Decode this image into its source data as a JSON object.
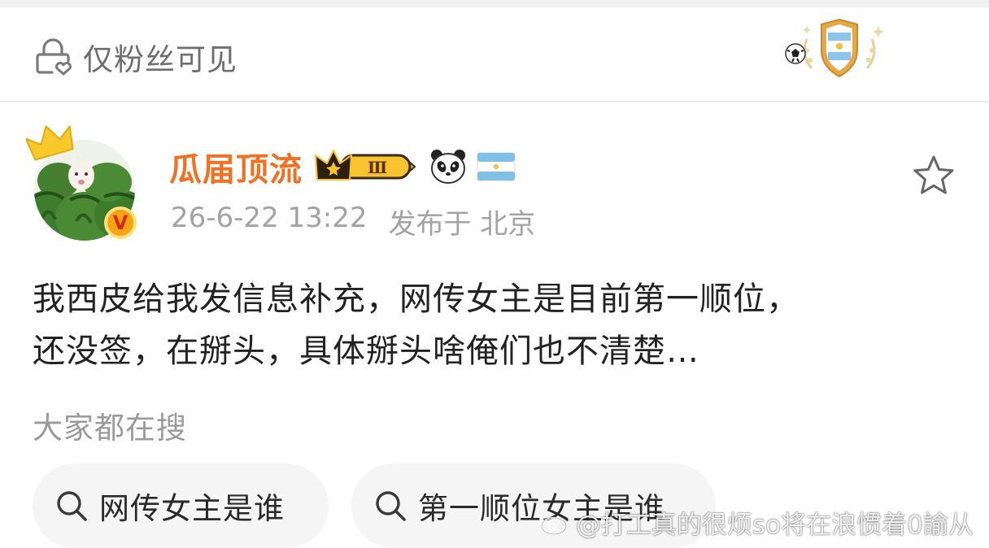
{
  "header": {
    "visibility_label": "仅粉丝可见"
  },
  "post": {
    "author": {
      "name": "瓜届顶流",
      "vip_level": "Ⅲ",
      "verified_mark": "V"
    },
    "time": "26-6-22 13:22",
    "location": "发布于 北京",
    "text_lines": [
      "我西皮给我发信息补充，网传女主是目前第一顺位，",
      "还没签，在掰头，具体掰头啥俺们也不清楚…"
    ]
  },
  "search": {
    "title": "大家都在搜",
    "chips": [
      {
        "label": "网传女主是谁"
      },
      {
        "label": "第一顺位女主是谁"
      }
    ]
  },
  "watermark": {
    "text": "@打工真的很烦so将在浪惯着0諭从"
  },
  "icons": {
    "visibility": "lock-heart-icon",
    "emblem": "argentina-football-emblem",
    "crown": "crown-icon",
    "star": "star-outline-icon",
    "search": "search-icon",
    "panda": "panda-emoji",
    "flag": "argentina-flag-emoji"
  },
  "colors": {
    "username": "#f07124",
    "secondary_text": "#a3a3a3",
    "chip_background": "#f5f5f5",
    "verified_badge": "#f4a415"
  }
}
